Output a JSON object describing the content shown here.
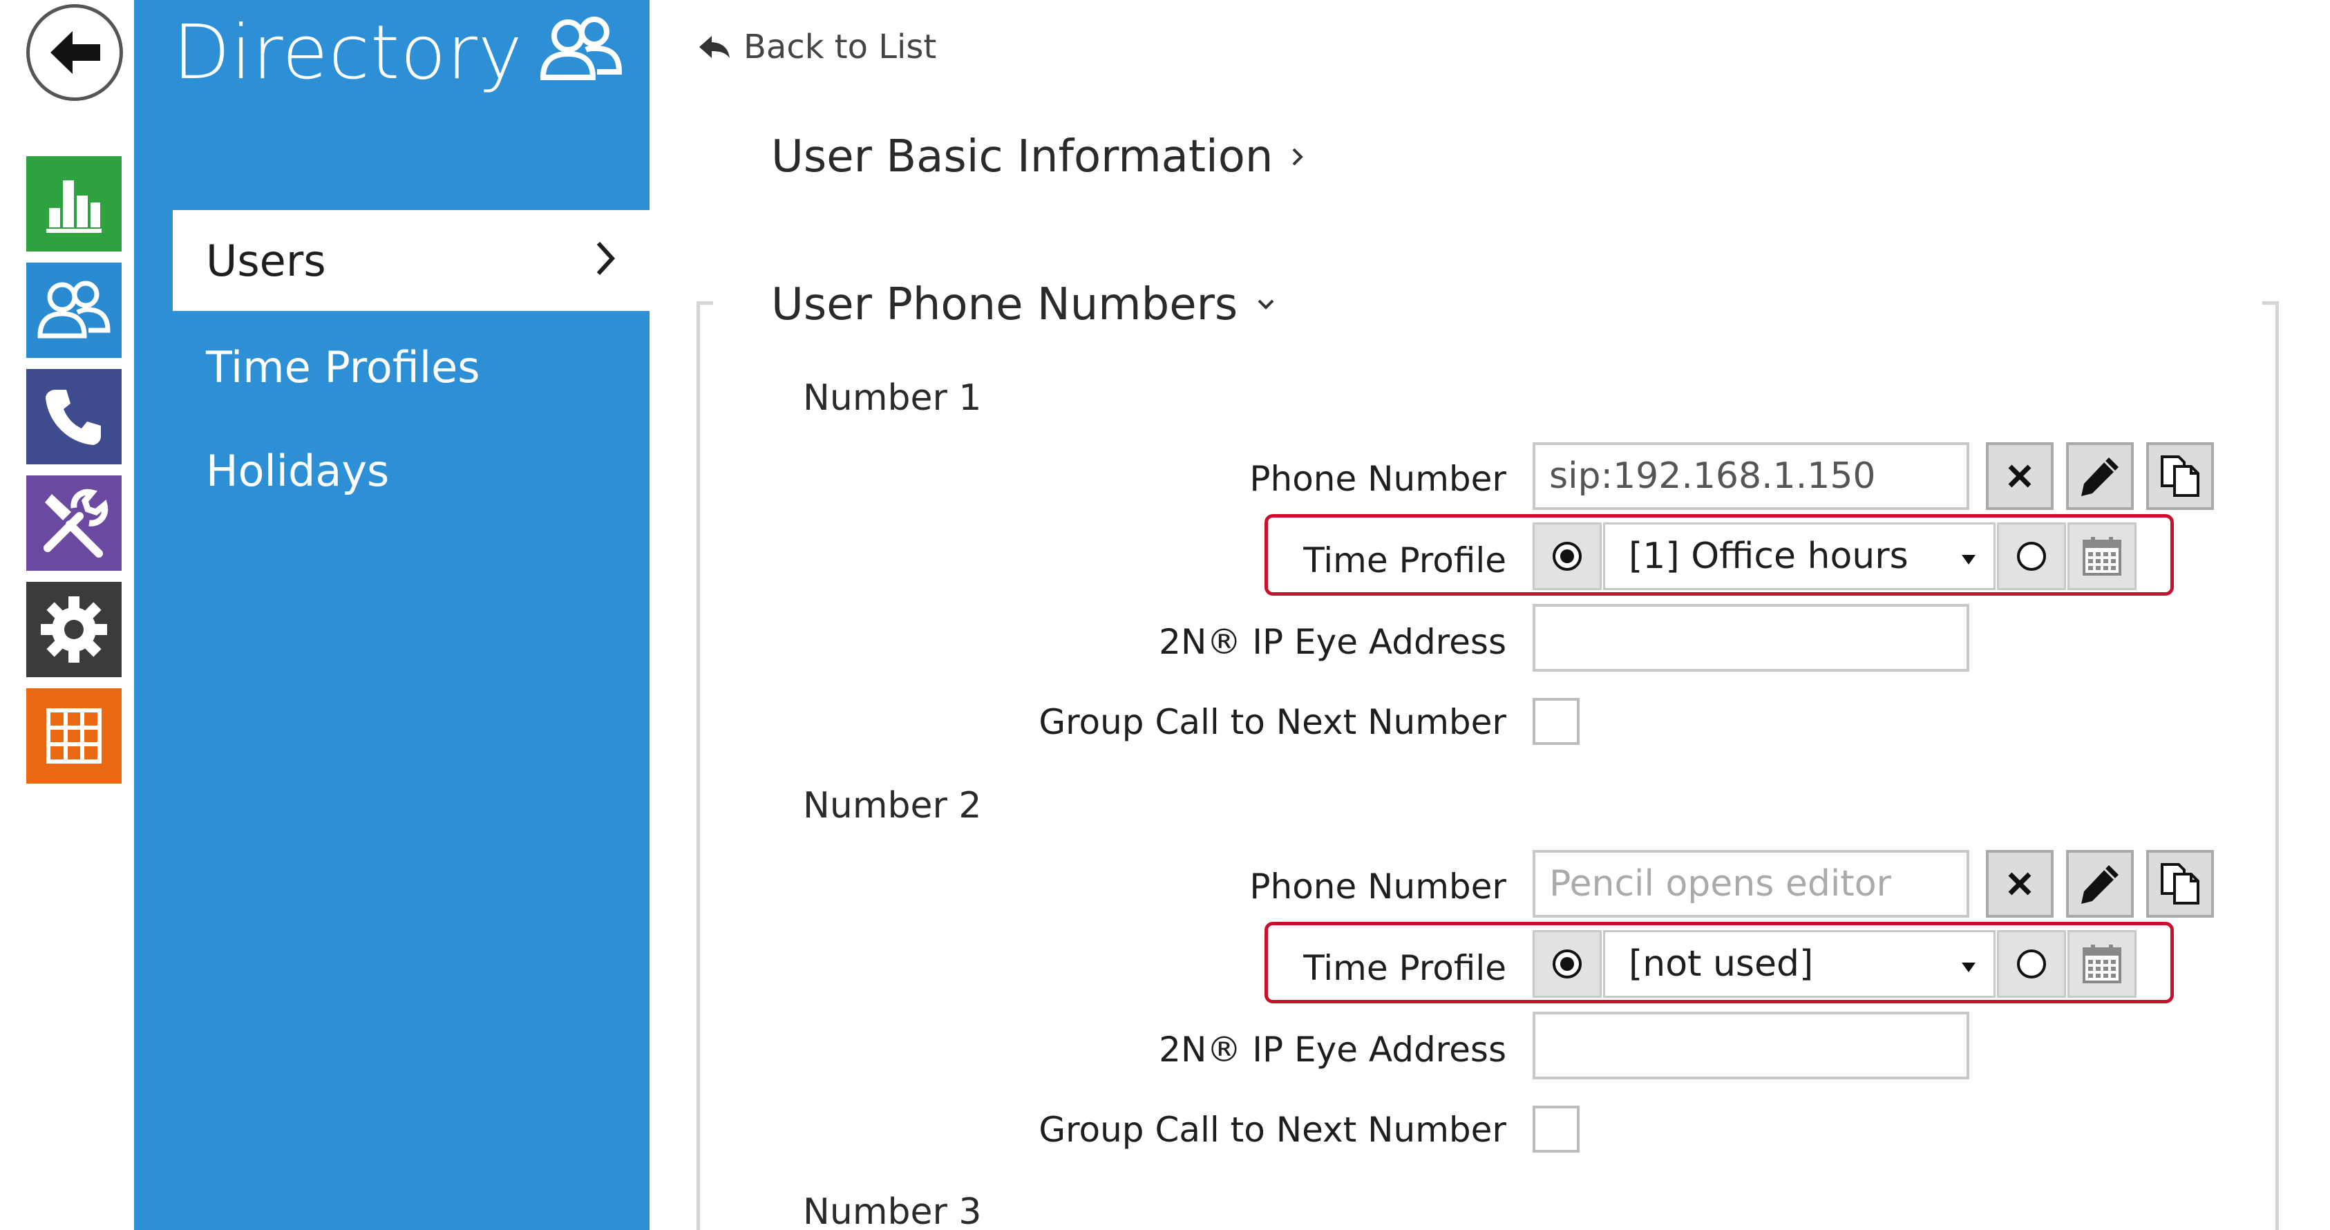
{
  "rail": {
    "back_icon": "back-arrow-icon",
    "tiles": [
      {
        "name": "status",
        "icon": "bar-chart-icon",
        "color": "#2ea23f"
      },
      {
        "name": "directory",
        "icon": "users-icon",
        "color": "#2b8bd2"
      },
      {
        "name": "calls",
        "icon": "phone-icon",
        "color": "#3e4c8e"
      },
      {
        "name": "hardware",
        "icon": "tools-icon",
        "color": "#6c49a1"
      },
      {
        "name": "services",
        "icon": "gear-icon",
        "color": "#3b3b3b"
      },
      {
        "name": "system",
        "icon": "grid-icon",
        "color": "#ea6a14"
      }
    ]
  },
  "nav": {
    "title": "Directory",
    "title_icon": "users-icon",
    "color": "#2d8fd5",
    "items": [
      {
        "label": "Users",
        "active": true
      },
      {
        "label": "Time Profiles",
        "active": false
      },
      {
        "label": "Holidays",
        "active": false
      }
    ]
  },
  "main": {
    "back_link": "Back to List",
    "sections": [
      {
        "title": "User Basic Information",
        "expanded": false
      },
      {
        "title": "User Phone Numbers",
        "expanded": true
      }
    ],
    "numbers": [
      {
        "heading": "Number 1",
        "phone_label": "Phone Number",
        "phone_value": "sip:192.168.1.150",
        "phone_placeholder": "",
        "time_profile_label": "Time Profile",
        "time_profile_value": "[1] Office hours",
        "eye_label": "2N® IP Eye Address",
        "eye_value": "",
        "group_call_label": "Group Call to Next Number",
        "group_call_checked": false
      },
      {
        "heading": "Number 2",
        "phone_label": "Phone Number",
        "phone_value": "",
        "phone_placeholder": "Pencil opens editor",
        "time_profile_label": "Time Profile",
        "time_profile_value": "[not used]",
        "eye_label": "2N® IP Eye Address",
        "eye_value": "",
        "group_call_label": "Group Call to Next Number",
        "group_call_checked": false
      },
      {
        "heading": "Number 3"
      }
    ],
    "highlight_color": "#c8102e"
  }
}
